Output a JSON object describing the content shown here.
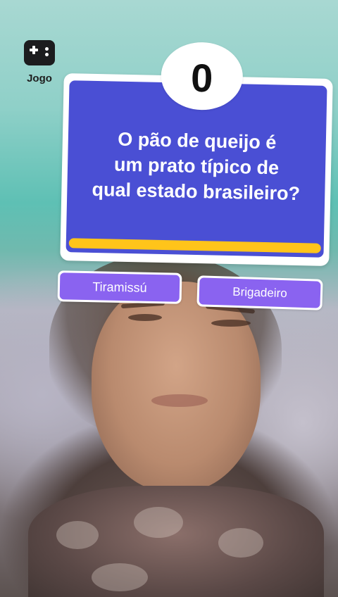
{
  "game_button": {
    "label": "Jogo",
    "icon": "gamepad-icon"
  },
  "quiz": {
    "score": "0",
    "question_lines": [
      "O pão de queijo é",
      "um prato típico de",
      "qual estado brasileiro?"
    ],
    "answers": [
      "Tiramissú",
      "Brigadeiro"
    ],
    "timer_fraction": 1.0
  },
  "colors": {
    "card_blue": "#4a4fd4",
    "answer_purple": "#8a63f0",
    "timer_yellow": "#ffc41a"
  }
}
